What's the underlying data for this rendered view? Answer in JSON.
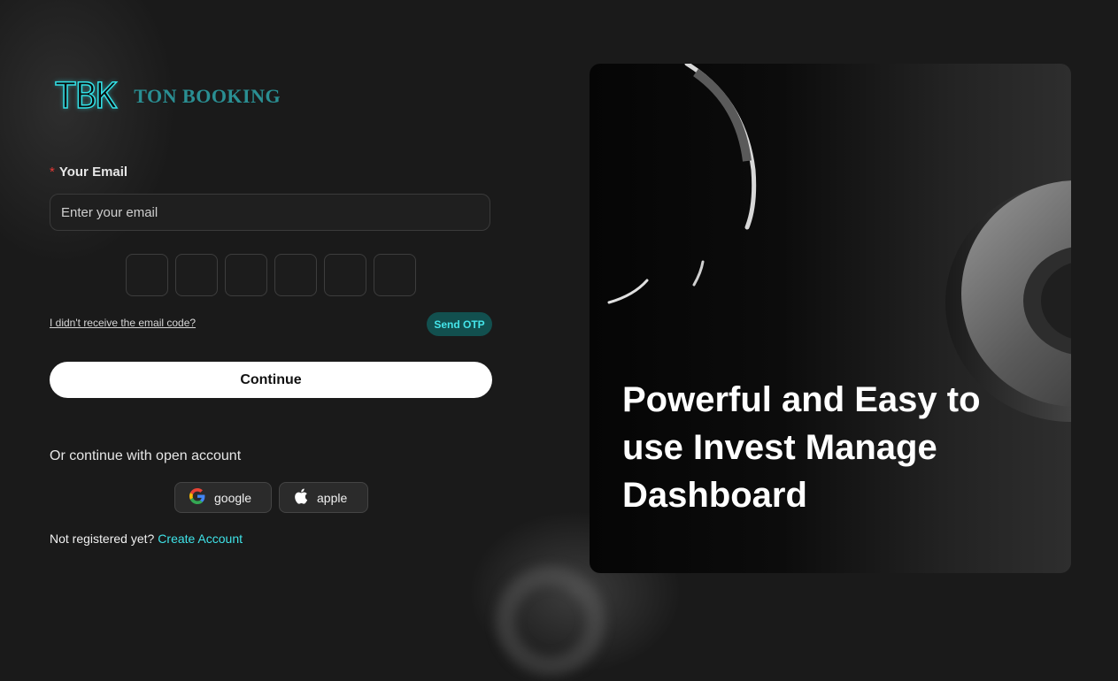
{
  "brand": {
    "mark": "TBK",
    "name": "TON BOOKING"
  },
  "form": {
    "email_label": "Your Email",
    "required_marker": "*",
    "email_placeholder": "Enter your email",
    "email_value": "",
    "otp_digits": [
      "",
      "",
      "",
      "",
      "",
      ""
    ],
    "resend_link": "I didn't receive the email code?",
    "send_otp_label": "Send OTP",
    "continue_label": "Continue"
  },
  "social": {
    "heading": "Or continue with open account",
    "google_label": "google",
    "apple_label": "apple",
    "google_icon": "google-icon",
    "apple_icon": "apple-icon"
  },
  "register": {
    "prompt": "Not registered yet?",
    "link": "Create Account"
  },
  "hero": {
    "headline": "Powerful and Easy to use Invest Manage Dashboard"
  },
  "colors": {
    "accent": "#3fe3e8",
    "background": "#1a1a1a",
    "send_otp_bg": "#12504f",
    "required": "#e53935"
  }
}
